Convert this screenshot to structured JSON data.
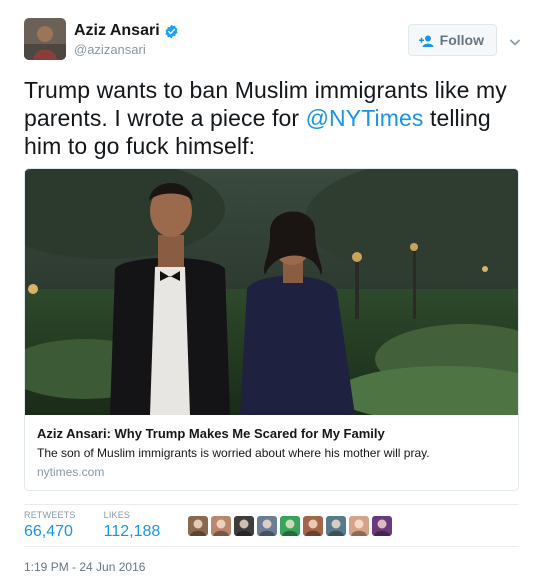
{
  "user": {
    "display_name": "Aziz Ansari",
    "handle": "@azizansari",
    "verified": true,
    "avatar_icon": "user-avatar"
  },
  "follow_button": {
    "label": "Follow",
    "icon": "add-user-icon"
  },
  "menu_caret": {
    "icon": "chevron-down-icon"
  },
  "tweet": {
    "text_before": "Trump wants to ban Muslim immigrants like my parents. I wrote a piece for ",
    "mention": "@NYTimes",
    "text_after": " telling him to go fuck himself:"
  },
  "card": {
    "title": "Aziz Ansari: Why Trump Makes Me Scared for My Family",
    "description": "The son of Muslim immigrants is worried about where his mother will pray.",
    "domain": "nytimes.com"
  },
  "stats": {
    "retweets_label": "RETWEETS",
    "retweets_value": "66,470",
    "likes_label": "LIKES",
    "likes_value": "112,188"
  },
  "likers": [
    {
      "color": "#8a6a4f"
    },
    {
      "color": "#b9876a"
    },
    {
      "color": "#3d3d3d"
    },
    {
      "color": "#6b7e96"
    },
    {
      "color": "#3aa35a"
    },
    {
      "color": "#a5654a"
    },
    {
      "color": "#587a8a"
    },
    {
      "color": "#d6a28a"
    },
    {
      "color": "#6a3a7a"
    }
  ],
  "timestamp": "1:19 PM - 24 Jun 2016",
  "colors": {
    "accent": "#1b95e0",
    "muted": "#8899a6",
    "verified": "#1da1f2"
  }
}
